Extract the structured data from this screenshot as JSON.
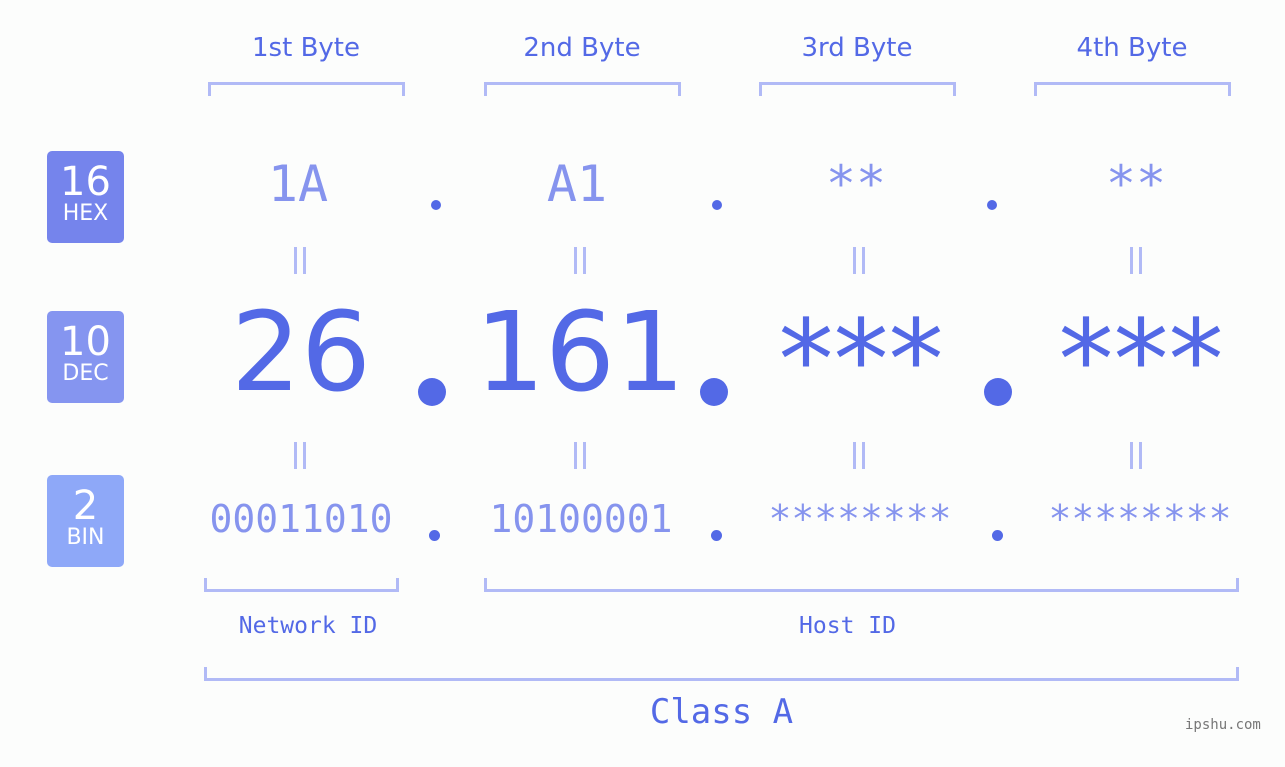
{
  "headers": [
    "1st Byte",
    "2nd Byte",
    "3rd Byte",
    "4th Byte"
  ],
  "badges": [
    {
      "number": "16",
      "label": "HEX",
      "color": "#7584ec"
    },
    {
      "number": "10",
      "label": "DEC",
      "color": "#8595f0"
    },
    {
      "number": "2",
      "label": "BIN",
      "color": "#8ea8f8"
    }
  ],
  "hex": [
    "1A",
    "A1",
    "**",
    "**"
  ],
  "dec": [
    "26",
    "161",
    "***",
    "***"
  ],
  "bin": [
    "00011010",
    "10100001",
    "********",
    "********"
  ],
  "labels": {
    "network_id": "Network ID",
    "host_id": "Host ID",
    "class": "Class A"
  },
  "watermark": "ipshu.com",
  "colors": {
    "accent": "#5369e6",
    "light": "#8694ee",
    "bracket": "#b1baf6"
  }
}
